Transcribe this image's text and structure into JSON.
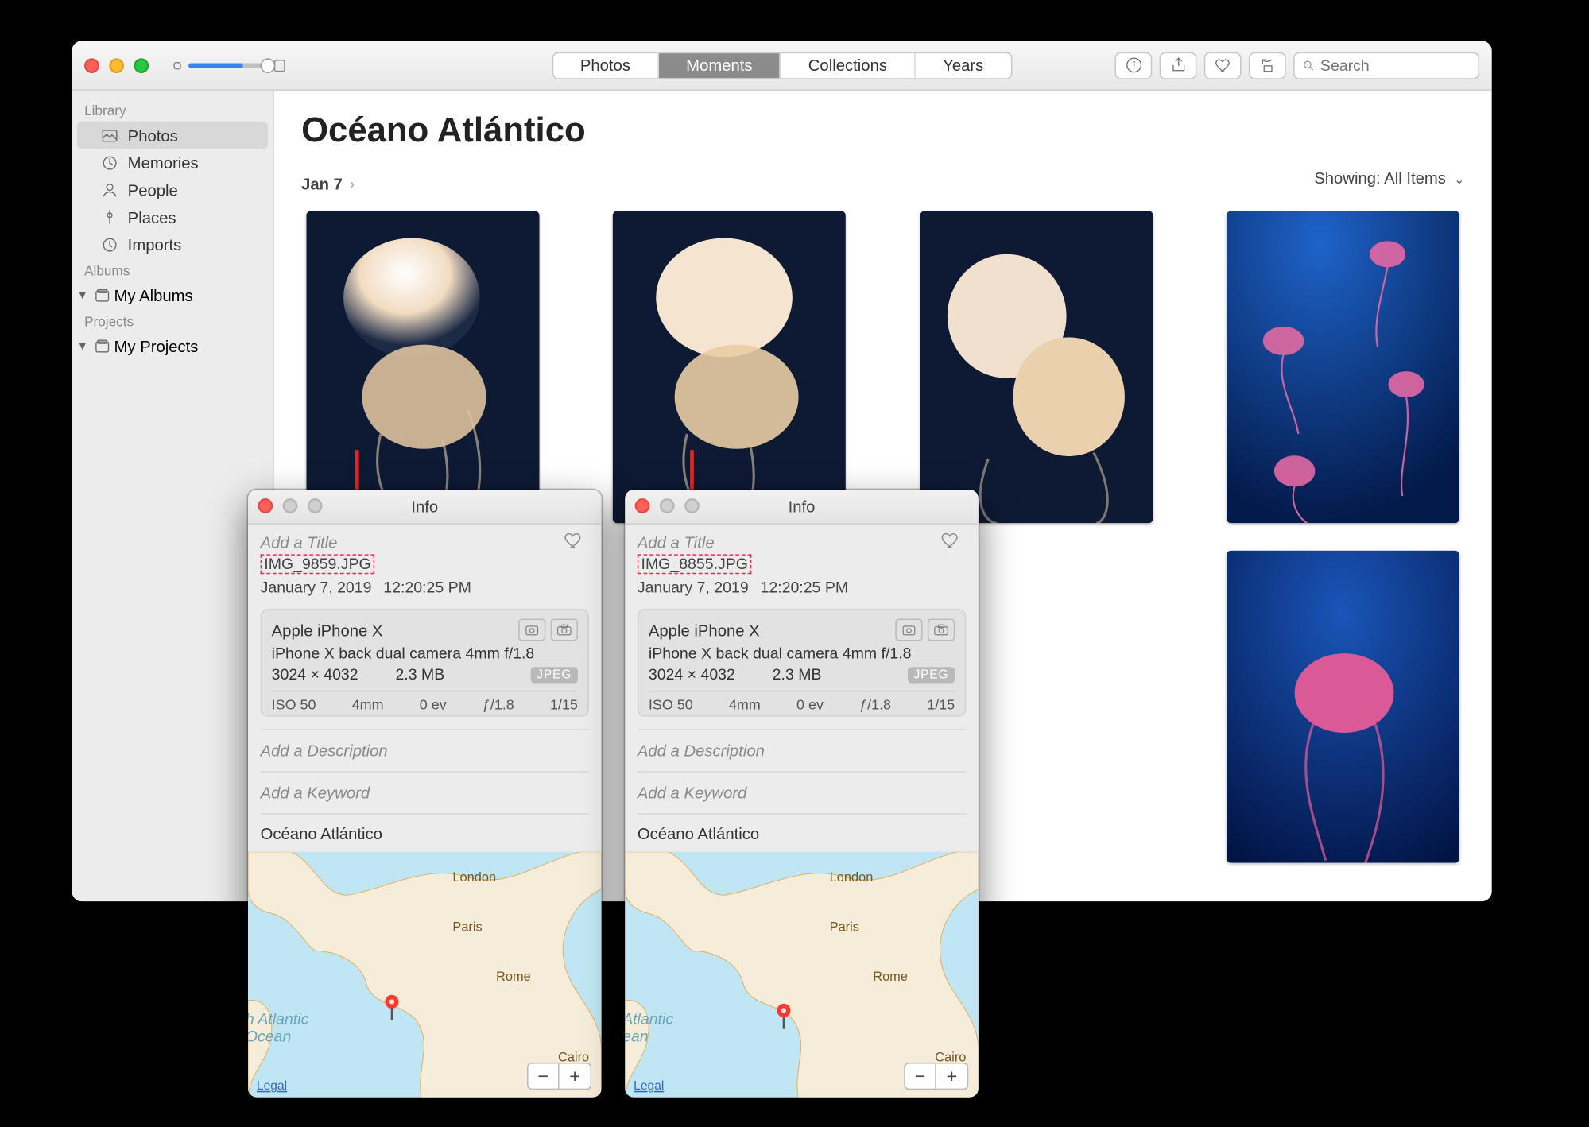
{
  "window": {
    "segments": [
      "Photos",
      "Moments",
      "Collections",
      "Years"
    ],
    "active_segment": 1,
    "search_placeholder": "Search"
  },
  "sidebar": {
    "sections": {
      "library": "Library",
      "albums": "Albums",
      "projects": "Projects"
    },
    "library_items": [
      {
        "label": "Photos",
        "icon": "photos",
        "selected": true
      },
      {
        "label": "Memories",
        "icon": "memories"
      },
      {
        "label": "People",
        "icon": "people"
      },
      {
        "label": "Places",
        "icon": "places"
      },
      {
        "label": "Imports",
        "icon": "imports"
      }
    ],
    "albums_group": "My Albums",
    "projects_group": "My Projects"
  },
  "content": {
    "title": "Océano Atlántico",
    "date": "Jan 7",
    "showing_label": "Showing:",
    "showing_value": "All Items"
  },
  "info_panels": [
    {
      "title": "Info",
      "add_title": "Add a Title",
      "filename": "IMG_9859.JPG",
      "date": "January 7, 2019",
      "time": "12:20:25 PM",
      "device": "Apple iPhone X",
      "lens": "iPhone X back dual camera 4mm f/1.8",
      "dimensions": "3024 × 4032",
      "filesize": "2.3 MB",
      "format": "JPEG",
      "iso": "ISO 50",
      "focal": "4mm",
      "ev": "0 ev",
      "aperture": "ƒ/1.8",
      "shutter": "1/15",
      "add_description": "Add a Description",
      "add_keyword": "Add a Keyword",
      "location": "Océano Atlántico",
      "map_labels": {
        "london": "London",
        "paris": "Paris",
        "rome": "Rome",
        "cairo": "Cairo"
      },
      "ocean_l1": "h Atlantic",
      "ocean_l2": "Ocean",
      "legal": "Legal",
      "zoom_minus": "−",
      "zoom_plus": "+"
    },
    {
      "title": "Info",
      "add_title": "Add a Title",
      "filename": "IMG_8855.JPG",
      "date": "January 7, 2019",
      "time": "12:20:25 PM",
      "device": "Apple iPhone X",
      "lens": "iPhone X back dual camera 4mm f/1.8",
      "dimensions": "3024 × 4032",
      "filesize": "2.3 MB",
      "format": "JPEG",
      "iso": "ISO 50",
      "focal": "4mm",
      "ev": "0 ev",
      "aperture": "ƒ/1.8",
      "shutter": "1/15",
      "add_description": "Add a Description",
      "add_keyword": "Add a Keyword",
      "location": "Océano Atlántico",
      "map_labels": {
        "london": "London",
        "paris": "Paris",
        "rome": "Rome",
        "cairo": "Cairo"
      },
      "ocean_l1": "Atlantic",
      "ocean_l2": "ean",
      "legal": "Legal",
      "zoom_minus": "−",
      "zoom_plus": "+"
    }
  ]
}
